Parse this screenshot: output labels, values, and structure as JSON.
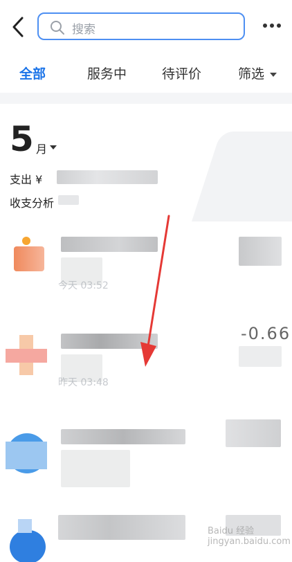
{
  "header": {
    "search_placeholder": "搜索"
  },
  "tabs": [
    {
      "label": "全部",
      "active": true
    },
    {
      "label": "服务中",
      "active": false
    },
    {
      "label": "待评价",
      "active": false
    },
    {
      "label": "筛选",
      "active": false
    }
  ],
  "summary": {
    "month": "5",
    "month_unit": "月",
    "expense_label": "支出 ¥",
    "analysis_label": "收支分析"
  },
  "list": [
    {
      "time": "今天 03:52",
      "amount": ""
    },
    {
      "time": "昨天 03:48",
      "amount": "-0.66"
    },
    {
      "time": "",
      "amount": ""
    },
    {
      "time": "",
      "amount": ""
    }
  ],
  "colors": {
    "accent": "#1a73e8",
    "search_border": "#4d8ff2",
    "arrow": "#e53935"
  },
  "watermark": {
    "text": "Baidu 经验 jingyan.baidu.com"
  }
}
